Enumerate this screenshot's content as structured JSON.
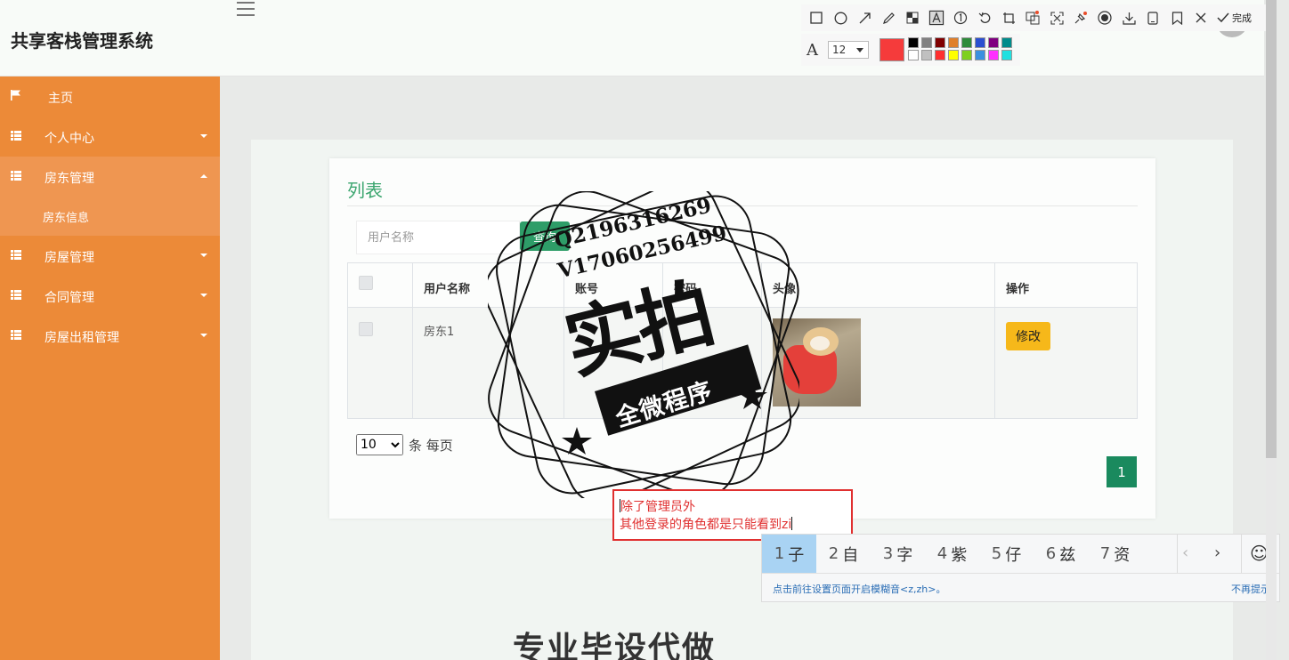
{
  "app": {
    "title": "共享客栈管理系统"
  },
  "sidebar": {
    "items": [
      {
        "label": "主页",
        "icon": "flag-icon"
      },
      {
        "label": "个人中心",
        "icon": "grid-icon"
      },
      {
        "label": "房东管理",
        "icon": "grid-icon",
        "expanded": true,
        "children": [
          {
            "label": "房东信息"
          }
        ]
      },
      {
        "label": "房屋管理",
        "icon": "grid-icon"
      },
      {
        "label": "合同管理",
        "icon": "grid-icon"
      },
      {
        "label": "房屋出租管理",
        "icon": "grid-icon"
      }
    ]
  },
  "main": {
    "card_title": "列表",
    "search": {
      "placeholder": "用户名称",
      "value": "",
      "button_label": "查询"
    },
    "table": {
      "columns": [
        "",
        "用户名称",
        "账号",
        "密码",
        "头像",
        "操作"
      ],
      "rows": [
        {
          "username": "房东1",
          "account": "",
          "password": "",
          "avatar": "shiba-dog-photo",
          "action_label": "修改"
        }
      ]
    },
    "pagination": {
      "page_size": "10",
      "page_size_suffix": "条 每页",
      "current_page": "1"
    },
    "colors": {
      "accent": "#2e9d68",
      "sidebar": "#ec8a38",
      "edit_button": "#f6b81a"
    }
  },
  "watermark": {
    "line1": "Q2196316269",
    "line2": "V17060256499",
    "main": "实拍",
    "band": "全微程序"
  },
  "annotation": {
    "line1": "除了管理员外",
    "line2": "其他登录的角色都是只能看到zi"
  },
  "ime": {
    "candidates": [
      {
        "n": "1",
        "c": "子"
      },
      {
        "n": "2",
        "c": "自"
      },
      {
        "n": "3",
        "c": "字"
      },
      {
        "n": "4",
        "c": "紫"
      },
      {
        "n": "5",
        "c": "仔"
      },
      {
        "n": "6",
        "c": "兹"
      },
      {
        "n": "7",
        "c": "资"
      }
    ],
    "hint": "点击前往设置页面开启模糊音<z,zh>。",
    "dismiss": "不再提示"
  },
  "capture_toolbar": {
    "done_label": "完成",
    "font_size": "12",
    "current_color": "#f53b3b",
    "palette": [
      "#000000",
      "#808080",
      "#800000",
      "#e0802a",
      "#2e8b3a",
      "#2a4fd0",
      "#800080",
      "#008b8b",
      "#ffffff",
      "#c0c0c0",
      "#ff3030",
      "#ffff00",
      "#7fd020",
      "#3a90e0",
      "#ff30ff",
      "#20e0e0"
    ]
  },
  "background_text": "专业毕设代做"
}
